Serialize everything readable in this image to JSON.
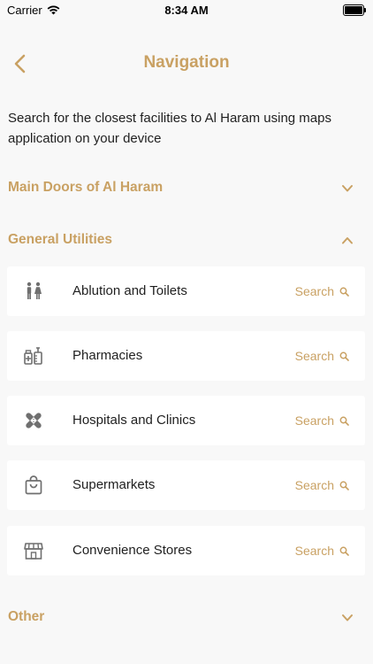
{
  "status": {
    "carrier": "Carrier",
    "time": "8:34 AM"
  },
  "header": {
    "title": "Navigation"
  },
  "intro": "Search for the closest facilities to Al Haram using maps application on your device",
  "sections": {
    "main_doors": {
      "label": "Main Doors of Al Haram",
      "expanded": false
    },
    "general_utilities": {
      "label": "General Utilities",
      "expanded": true
    },
    "other": {
      "label": "Other",
      "expanded": false
    }
  },
  "utilities": [
    {
      "label": "Ablution and Toilets",
      "action": "Search",
      "icon": "restroom-icon"
    },
    {
      "label": "Pharmacies",
      "action": "Search",
      "icon": "pharmacy-icon"
    },
    {
      "label": "Hospitals and Clinics",
      "action": "Search",
      "icon": "bandage-icon"
    },
    {
      "label": "Supermarkets",
      "action": "Search",
      "icon": "shopping-bag-icon"
    },
    {
      "label": "Convenience Stores",
      "action": "Search",
      "icon": "store-icon"
    }
  ],
  "colors": {
    "accent": "#c9a163",
    "background": "#f8f8f8",
    "card": "#ffffff",
    "text": "#1f1f1f",
    "icon": "#6f6f6f"
  }
}
